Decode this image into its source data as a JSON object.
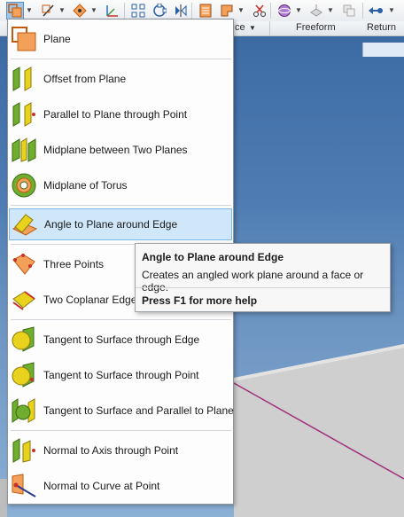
{
  "ribbon": {
    "labels": [
      "ce",
      "Freeform",
      "Return"
    ],
    "dropdown_glyph": "▼"
  },
  "menu": {
    "items": [
      {
        "label": "Plane",
        "icon": "plane-icon"
      },
      {
        "label": "Offset from Plane",
        "icon": "offset-plane-icon"
      },
      {
        "label": "Parallel to Plane through Point",
        "icon": "parallel-plane-point-icon"
      },
      {
        "label": "Midplane between Two Planes",
        "icon": "midplane-two-planes-icon"
      },
      {
        "label": "Midplane of Torus",
        "icon": "midplane-torus-icon"
      },
      {
        "label": "Angle to Plane around Edge",
        "icon": "angle-plane-edge-icon",
        "highlighted": true
      },
      {
        "label": "Three Points",
        "icon": "three-points-icon"
      },
      {
        "label": "Two Coplanar Edges",
        "icon": "two-coplanar-edges-icon"
      },
      {
        "label": "Tangent to Surface through Edge",
        "icon": "tangent-surface-edge-icon"
      },
      {
        "label": "Tangent to Surface through Point",
        "icon": "tangent-surface-point-icon"
      },
      {
        "label": "Tangent to Surface and Parallel to Plane",
        "icon": "tangent-surface-parallel-icon"
      },
      {
        "label": "Normal to Axis through Point",
        "icon": "normal-axis-point-icon"
      },
      {
        "label": "Normal to Curve at Point",
        "icon": "normal-curve-point-icon"
      }
    ]
  },
  "tooltip": {
    "title": "Angle to Plane around Edge",
    "description": "Creates an angled work plane around a face or edge.",
    "help": "Press F1 for more help"
  },
  "colors": {
    "highlight": "#cfe7f9",
    "plane_orange": "#f2a05a",
    "plane_green": "#6fae2f",
    "plane_yellow": "#e8d21c"
  }
}
